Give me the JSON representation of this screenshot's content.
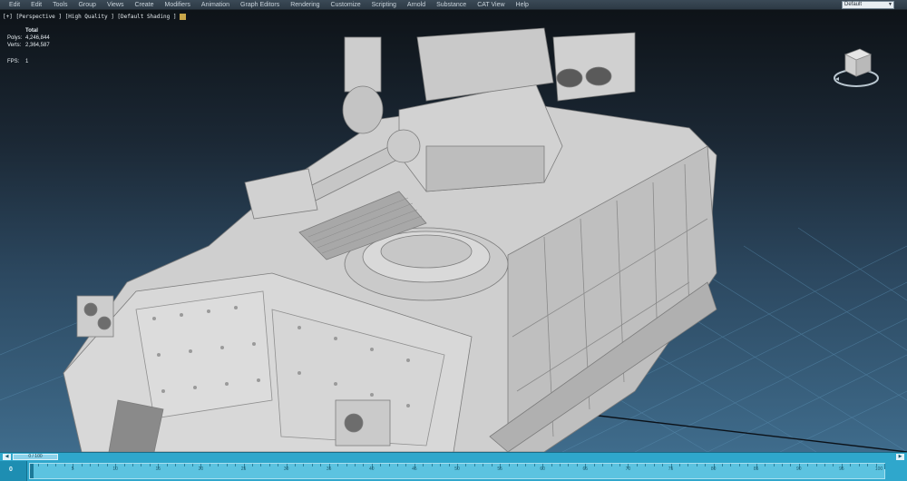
{
  "menu": {
    "items": [
      {
        "label": "Edit"
      },
      {
        "label": "Edit"
      },
      {
        "label": "Tools"
      },
      {
        "label": "Group"
      },
      {
        "label": "Views"
      },
      {
        "label": "Create"
      },
      {
        "label": "Modifiers"
      },
      {
        "label": "Animation"
      },
      {
        "label": "Graph Editors"
      },
      {
        "label": "Rendering"
      },
      {
        "label": "Customize"
      },
      {
        "label": "Scripting"
      },
      {
        "label": "Arnold"
      },
      {
        "label": "Substance"
      },
      {
        "label": "CAT View"
      },
      {
        "label": "Help"
      }
    ],
    "workspace": "Default"
  },
  "viewport": {
    "label": "[+] [Perspective ] [High Quality ] [Default Shading ]",
    "stats": {
      "header": "Total",
      "polys_label": "Polys:",
      "polys_value": "4,246,844",
      "verts_label": "Verts:",
      "verts_value": "2,364,587",
      "fps_label": "FPS:",
      "fps_value": "1"
    },
    "viewcube_icon": "viewcube-icon",
    "model_color": "#d9d9d9",
    "background_top": "#0e1318",
    "background_bottom": "#3f6c8c"
  },
  "time_slider": {
    "position_text": "0 / 100",
    "prev_icon": "chevron-left-icon",
    "next_icon": "chevron-right-icon"
  },
  "trackbar": {
    "current_frame": "0",
    "ticks": [
      "5",
      "10",
      "15",
      "20",
      "25",
      "30",
      "35",
      "40",
      "45",
      "50",
      "55",
      "60",
      "65",
      "70",
      "75",
      "80",
      "85",
      "90",
      "95",
      "100"
    ],
    "accent": "#2fa7cc"
  }
}
